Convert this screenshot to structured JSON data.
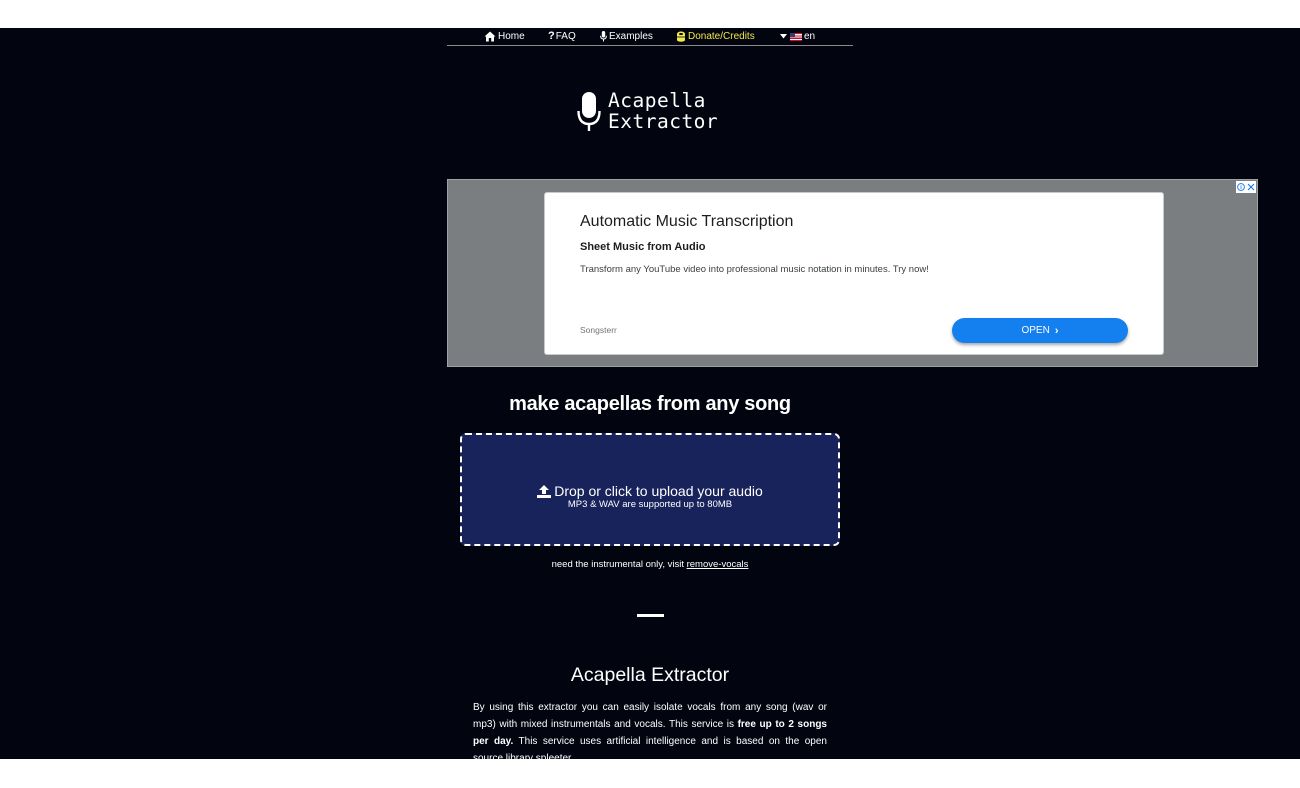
{
  "nav": {
    "home": "Home",
    "faq": "FAQ",
    "examples": "Examples",
    "donate": "Donate/Credits",
    "language": "en"
  },
  "logo": {
    "line1": "Acapella",
    "line2": "Extractor"
  },
  "ad": {
    "title": "Automatic Music Transcription",
    "subtitle": "Sheet Music from Audio",
    "description": "Transform any YouTube video into professional music notation in minutes. Try now!",
    "brand": "Songsterr",
    "open_label": "OPEN"
  },
  "main": {
    "headline": "make acapellas from any song",
    "upload_label": "Drop or click to upload your audio",
    "upload_hint": "MP3 & WAV are supported up to 80MB",
    "instrumental_prefix": "need the instrumental only, visit",
    "instrumental_link": "remove-vocals",
    "section_title": "Acapella Extractor",
    "para_1": "By using this extractor you can easily isolate vocals from any song (wav or mp3) with mixed instrumentals and vocals. This service is ",
    "para_bold": "free up to 2 songs per day.",
    "para_2": " This service uses artificial intelligence and is based on the open source library spleeter."
  },
  "colors": {
    "background": "#020510",
    "dropzone": "#17235a",
    "donate": "#f1e84a",
    "open_button": "#1480f0"
  }
}
